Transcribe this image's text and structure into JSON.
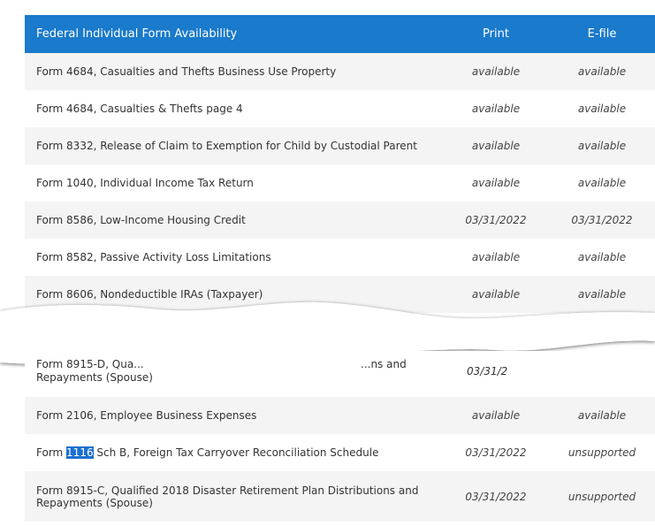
{
  "table": {
    "headers": {
      "name": "Federal Individual Form Availability",
      "print": "Print",
      "efile": "E-file"
    },
    "rows_top": [
      {
        "name": "Form 4684, Casualties and Thefts Business Use Property",
        "print": "available",
        "efile": "available"
      },
      {
        "name": "Form 4684, Casualties & Thefts page 4",
        "print": "available",
        "efile": "available"
      },
      {
        "name": "Form 8332, Release of Claim to Exemption for Child by Custodial Parent",
        "print": "available",
        "efile": "available"
      },
      {
        "name": "Form 1040, Individual Income Tax Return",
        "print": "available",
        "efile": "available"
      },
      {
        "name": "Form 8586, Low-Income Housing Credit",
        "print": "03/31/2022",
        "efile": "03/31/2022"
      },
      {
        "name": "Form 8582, Passive Activity Loss Limitations",
        "print": "available",
        "efile": "available"
      },
      {
        "name": "Form 8606, Nondeductible IRAs (Taxpayer)",
        "print": "available",
        "efile": "available"
      }
    ],
    "torn_row": {
      "name_fragment_1": "Form 8915-D, Qua...",
      "name_fragment_2": "...ns and",
      "name_line_2": "Repayments (Spouse)",
      "print_fragment": "03/31/2"
    },
    "rows_bottom": [
      {
        "name": "Form 2106, Employee Business Expenses",
        "print": "available",
        "efile": "available"
      },
      {
        "name_prefix": "Form ",
        "name_highlight": "1116",
        "name_suffix": " Sch B, Foreign Tax Carryover Reconciliation Schedule",
        "print": "03/31/2022",
        "efile": "unsupported"
      },
      {
        "name_line_1": "Form 8915-C, Qualified 2018 Disaster Retirement Plan Distributions and",
        "name_line_2": "Repayments (Spouse)",
        "print": "03/31/2022",
        "efile": "unsupported"
      }
    ]
  },
  "colors": {
    "header_bg": "#1a7acb",
    "row_shade": "#f4f4f4",
    "highlight": "#1a6fd0"
  }
}
